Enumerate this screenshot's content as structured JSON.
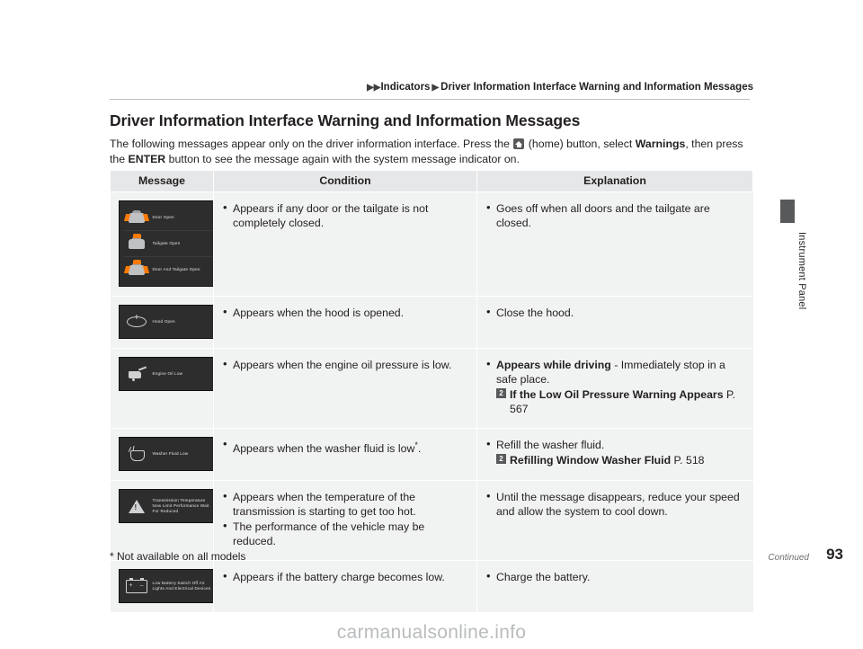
{
  "breadcrumb": {
    "arrow": "▶",
    "items": [
      "Indicators",
      "Driver Information Interface Warning and Information Messages"
    ],
    "separator": "▶"
  },
  "title": "Driver Information Interface Warning and Information Messages",
  "intro": {
    "part1": "The following messages appear only on the driver information interface. Press the ",
    "icon": "home-icon",
    "part2": " (home) button, select ",
    "bold1": "Warnings",
    "part3": ", then press the ",
    "bold2": "ENTER",
    "part4": " button to see the message again with the system message indicator on."
  },
  "table": {
    "headers": [
      "Message",
      "Condition",
      "Explanation"
    ],
    "rows": [
      {
        "display": {
          "lines": [
            "Door Open",
            "Tailgate Open",
            "Door And Tailgate Open"
          ],
          "icons": [
            "car-door-open-icon",
            "car-tailgate-open-icon",
            "car-door-and-tailgate-open-icon"
          ]
        },
        "condition": [
          "Appears if any door or the tailgate is not completely closed."
        ],
        "explanation": [
          "Goes off when all doors and the tailgate are closed."
        ]
      },
      {
        "display": {
          "lines": [
            "Hood Open"
          ],
          "icons": [
            "hood-open-icon"
          ]
        },
        "condition": [
          "Appears when the hood is opened."
        ],
        "explanation": [
          "Close the hood."
        ]
      },
      {
        "display": {
          "lines": [
            "Engine Oil Low"
          ],
          "icons": [
            "oil-can-icon"
          ]
        },
        "condition": [
          "Appears when the engine oil pressure is low."
        ],
        "explanation": [
          "Appears while driving - Immediately stop in a safe place."
        ],
        "explanation_bold_prefix": "Appears while driving",
        "explanation_rest": " - Immediately stop in a safe place.",
        "reference": {
          "mark": "2",
          "text": "If the Low Oil Pressure Warning Appears",
          "page": "P. 567"
        }
      },
      {
        "display": {
          "lines": [
            "Washer Fluid Low"
          ],
          "icons": [
            "washer-fluid-icon"
          ]
        },
        "condition": [
          "Appears when the washer fluid is low"
        ],
        "condition_sup": "*",
        "condition_tail": ".",
        "explanation": [
          "Refill the washer fluid."
        ],
        "reference": {
          "mark": "2",
          "text": "Refilling Window Washer Fluid",
          "page": "P. 518"
        }
      },
      {
        "display": {
          "lines": [
            "Transmission Temperature Now Limit Performance Wait For Reduced"
          ],
          "icons": [
            "transmission-temperature-icon"
          ]
        },
        "condition": [
          "Appears when the temperature of the transmission is starting to get too hot.",
          "The performance of the vehicle may be reduced."
        ],
        "explanation": [
          "Until the message disappears, reduce your speed and allow the system to cool down."
        ]
      },
      {
        "display": {
          "lines": [
            "Low Battery Switch Off Air Lights And Electrical Devices"
          ],
          "icons": [
            "battery-icon"
          ]
        },
        "condition": [
          "Appears if the battery charge becomes low."
        ],
        "explanation": [
          "Charge the battery."
        ]
      }
    ]
  },
  "side_tab_label": "Instrument Panel",
  "footnote": "* Not available on all models",
  "continued": "Continued",
  "page_number": "93",
  "watermark": "carmanualsonline.info"
}
